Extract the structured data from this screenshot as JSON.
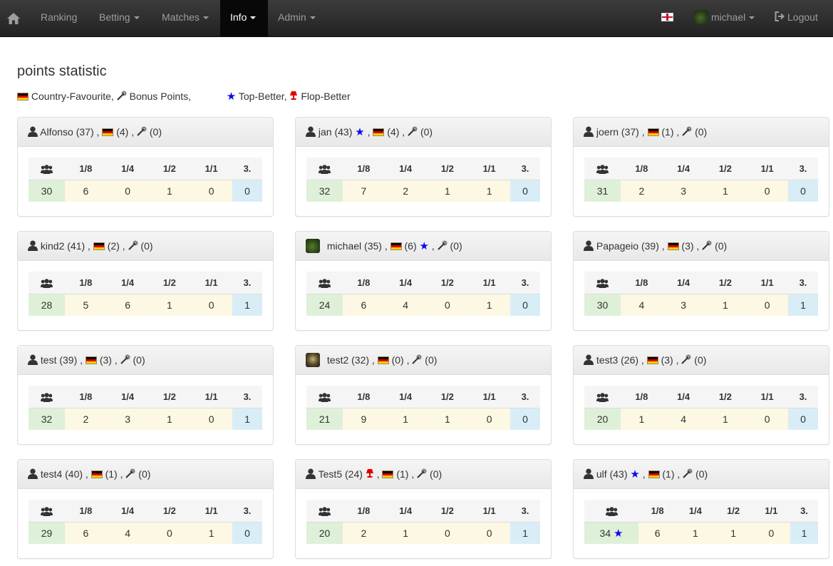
{
  "nav": {
    "home_icon": "home-icon",
    "items": [
      {
        "label": "Ranking",
        "caret": false
      },
      {
        "label": "Betting",
        "caret": true
      },
      {
        "label": "Matches",
        "caret": true
      },
      {
        "label": "Info",
        "caret": true,
        "active": true
      },
      {
        "label": "Admin",
        "caret": true
      }
    ],
    "language_icon": "english-flag-icon",
    "user": "michael",
    "logout": "Logout",
    "colors": {
      "bar": "#222222",
      "active": "#080808",
      "text": "#9d9d9d"
    }
  },
  "page": {
    "title": "points statistic",
    "legend": {
      "country": "Country-Favourite,",
      "bonus": "Bonus Points,",
      "top": "Top-Better,",
      "flop": "Flop-Better"
    }
  },
  "columns": [
    "1/8",
    "1/4",
    "1/2",
    "1/1",
    "3."
  ],
  "users_icon": "users-icon",
  "colors": {
    "users_cell": "#dff0d8",
    "stage_cell": "#fcf8e3",
    "third_cell": "#d9edf7",
    "star": "#0000ff",
    "flop": "#dd0000"
  },
  "cards": [
    {
      "name": "Alfonso",
      "points": "(37)",
      "country": "(4)",
      "bonus": "(0)",
      "users": "30",
      "stages": [
        "6",
        "0",
        "1",
        "0",
        "0"
      ]
    },
    {
      "name": "jan",
      "points": "(43)",
      "country": "(4)",
      "bonus": "(0)",
      "users": "32",
      "stages": [
        "7",
        "2",
        "1",
        "1",
        "0"
      ],
      "top": true
    },
    {
      "name": "joern",
      "points": "(37)",
      "country": "(1)",
      "bonus": "(0)",
      "users": "31",
      "stages": [
        "2",
        "3",
        "1",
        "0",
        "0"
      ]
    },
    {
      "name": "kind2",
      "points": "(41)",
      "country": "(2)",
      "bonus": "(0)",
      "users": "28",
      "stages": [
        "5",
        "6",
        "1",
        "0",
        "1"
      ]
    },
    {
      "name": "michael",
      "points": "(35)",
      "country": "(6)",
      "bonus": "(0)",
      "users": "24",
      "stages": [
        "6",
        "4",
        "0",
        "1",
        "0"
      ],
      "country_top": true
    },
    {
      "name": "Papageio",
      "points": "(39)",
      "country": "(3)",
      "bonus": "(0)",
      "users": "30",
      "stages": [
        "4",
        "3",
        "1",
        "0",
        "1"
      ]
    },
    {
      "name": "test",
      "points": "(39)",
      "country": "(3)",
      "bonus": "(0)",
      "users": "32",
      "stages": [
        "2",
        "3",
        "1",
        "0",
        "1"
      ]
    },
    {
      "name": "test2",
      "points": "(32)",
      "country": "(0)",
      "bonus": "(0)",
      "users": "21",
      "stages": [
        "9",
        "1",
        "1",
        "0",
        "0"
      ]
    },
    {
      "name": "test3",
      "points": "(26)",
      "country": "(3)",
      "bonus": "(0)",
      "users": "20",
      "stages": [
        "1",
        "4",
        "1",
        "0",
        "0"
      ]
    },
    {
      "name": "test4",
      "points": "(40)",
      "country": "(1)",
      "bonus": "(0)",
      "users": "29",
      "stages": [
        "6",
        "4",
        "0",
        "1",
        "0"
      ]
    },
    {
      "name": "Test5",
      "points": "(24)",
      "country": "(1)",
      "bonus": "(0)",
      "users": "20",
      "stages": [
        "2",
        "1",
        "0",
        "0",
        "1"
      ],
      "flop": true
    },
    {
      "name": "ulf",
      "points": "(43)",
      "country": "(1)",
      "bonus": "(0)",
      "users": "34",
      "stages": [
        "6",
        "1",
        "1",
        "0",
        "1"
      ],
      "top": true,
      "users_top": true
    }
  ]
}
